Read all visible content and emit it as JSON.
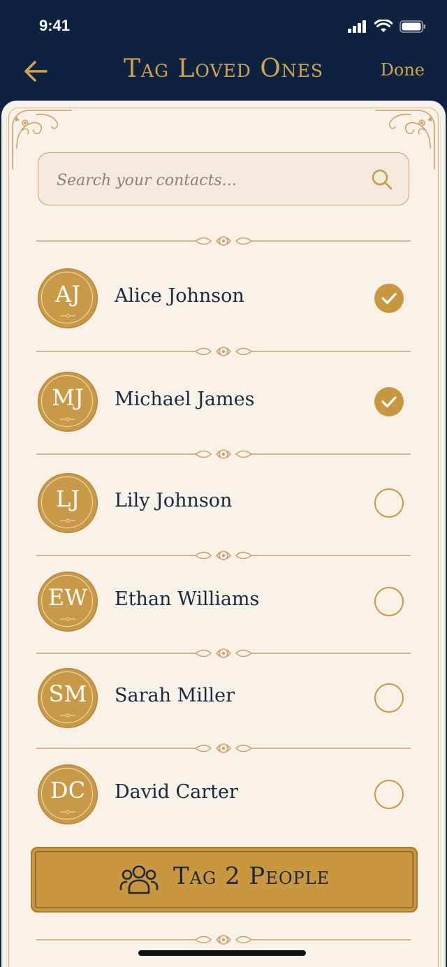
{
  "status": {
    "time": "9:41"
  },
  "header": {
    "title": "Tag Loved Ones",
    "done_label": "Done"
  },
  "search": {
    "placeholder": "Search your contacts...",
    "value": ""
  },
  "contacts": [
    {
      "initials": "AJ",
      "name": "Alice Johnson",
      "selected": true
    },
    {
      "initials": "MJ",
      "name": "Michael James",
      "selected": true
    },
    {
      "initials": "LJ",
      "name": "Lily Johnson",
      "selected": false
    },
    {
      "initials": "EW",
      "name": "Ethan Williams",
      "selected": false
    },
    {
      "initials": "SM",
      "name": "Sarah Miller",
      "selected": false
    },
    {
      "initials": "DC",
      "name": "David Carter",
      "selected": false
    }
  ],
  "cta": {
    "label": "Tag 2 People"
  },
  "colors": {
    "navy": "#0e2340",
    "gold": "#c9973f",
    "cream": "#f7f1e7"
  }
}
